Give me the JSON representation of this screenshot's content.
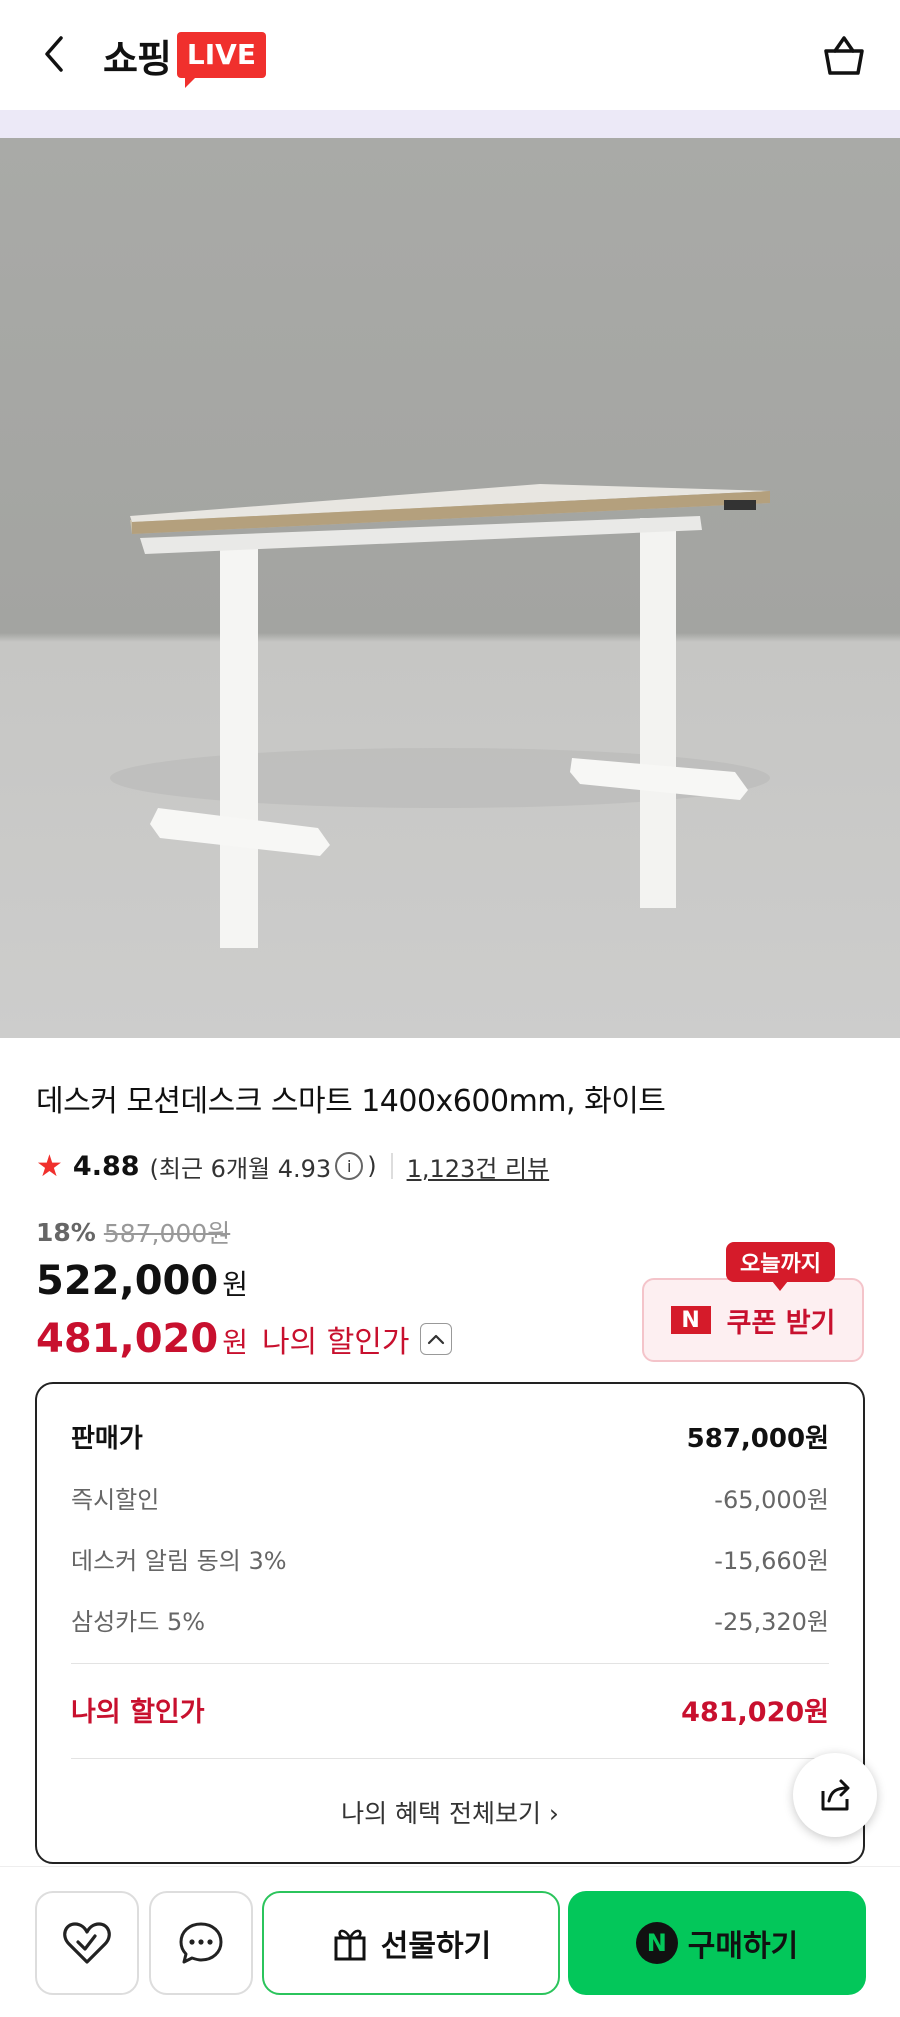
{
  "header": {
    "logo_text": "쇼핑",
    "logo_badge": "LIVE",
    "back_icon": "chevron-left-icon",
    "cart_icon": "basket-icon"
  },
  "product": {
    "title": "데스커 모션데스크 스마트 1400x600mm, 화이트",
    "image_alt": "white motion desk on grey background"
  },
  "rating": {
    "score": "4.88",
    "recent_prefix": "(최근 6개월 4.93",
    "recent_suffix": ")",
    "reviews": "1,123건 리뷰"
  },
  "price": {
    "discount_pct": "18%",
    "original": "587,000원",
    "sale": "522,000",
    "won": "원",
    "my_price": "481,020",
    "my_price_label": "나의 할인가"
  },
  "coupon": {
    "badge": "오늘까지",
    "n_mark": "N",
    "label": "쿠폰 받기"
  },
  "breakdown": {
    "rows": [
      {
        "label": "판매가",
        "value": "587,000원"
      },
      {
        "label": "즉시할인",
        "value": "-65,000원"
      },
      {
        "label": "데스커 알림 동의 3%",
        "value": "-15,660원"
      },
      {
        "label": "삼성카드 5%",
        "value": "-25,320원"
      }
    ],
    "mine": {
      "label": "나의 할인가",
      "value": "481,020원"
    },
    "view_all": "나의 혜택 전체보기 ›"
  },
  "bottom": {
    "gift_label": "선물하기",
    "buy_label": "구매하기",
    "buy_mark": "N"
  },
  "colors": {
    "accent_red": "#c8102e",
    "live_red": "#f0302d",
    "naver_green": "#03c75a"
  }
}
